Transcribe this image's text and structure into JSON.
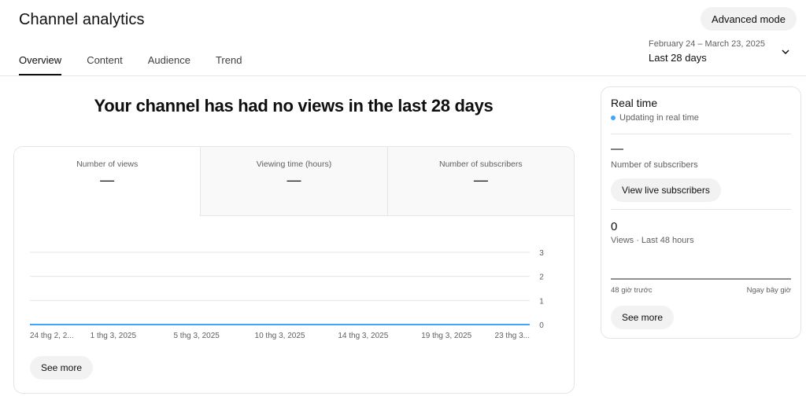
{
  "header": {
    "title": "Channel analytics",
    "advanced_mode": "Advanced mode"
  },
  "tabs": [
    {
      "label": "Overview",
      "active": true
    },
    {
      "label": "Content",
      "active": false
    },
    {
      "label": "Audience",
      "active": false
    },
    {
      "label": "Trend",
      "active": false
    }
  ],
  "date_picker": {
    "range": "February 24 – March 23, 2025",
    "label": "Last 28 days",
    "icon": "chevron-down-icon"
  },
  "main": {
    "headline": "Your channel has had no views in the last 28 days",
    "metrics": [
      {
        "name": "Number of views",
        "value": "—",
        "active": true
      },
      {
        "name": "Viewing time (hours)",
        "value": "—",
        "active": false
      },
      {
        "name": "Number of subscribers",
        "value": "—",
        "active": false
      }
    ],
    "see_more": "See more"
  },
  "chart_data": {
    "type": "line",
    "x": [
      "24 thg 2, 2...",
      "1 thg 3, 2025",
      "5 thg 3, 2025",
      "10 thg 3, 2025",
      "14 thg 3, 2025",
      "19 thg 3, 2025",
      "23 thg 3..."
    ],
    "series": [
      {
        "values": [
          0,
          0,
          0,
          0,
          0,
          0,
          0
        ]
      }
    ],
    "yticks": [
      "0",
      "1",
      "2",
      "3"
    ],
    "ylim": [
      0,
      3
    ],
    "grid": true,
    "line_color": "#3ea6ff"
  },
  "realtime": {
    "title": "Real time",
    "status": "Updating in real time",
    "status_color": "#3ea6ff",
    "subscribers_value": "—",
    "subscribers_label": "Number of subscribers",
    "live_button": "View live subscribers",
    "views_value": "0",
    "views_label": "Views · Last 48 hours",
    "axis_left": "48 giờ trước",
    "axis_right": "Ngay bây giờ",
    "see_more": "See more"
  }
}
